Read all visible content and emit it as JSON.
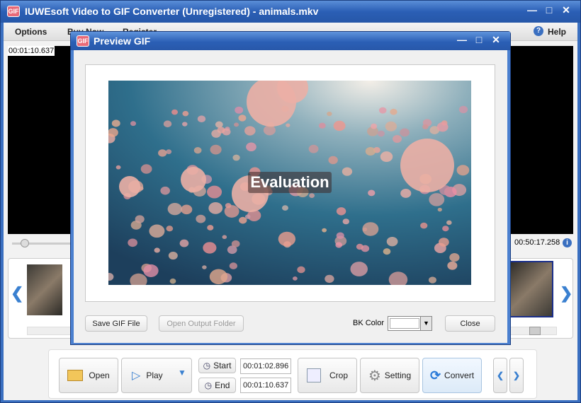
{
  "window": {
    "title": "IUWEsoft Video to GIF Converter (Unregistered) - animals.mkv",
    "icon": "app-logo-icon"
  },
  "menu": {
    "items": [
      "Options",
      "Buy Now",
      "Register"
    ],
    "help": "Help"
  },
  "player": {
    "current_time": "00:01:10.637",
    "total_time": "00:50:17.258",
    "position_fraction": 0.02
  },
  "toolbar": {
    "open": "Open",
    "play": "Play",
    "start": "Start",
    "end": "End",
    "start_time": "00:01:02.896",
    "end_time": "00:01:10.637",
    "crop": "Crop",
    "setting": "Setting",
    "convert": "Convert"
  },
  "dialog": {
    "title": "Preview GIF",
    "watermark": "Evaluation",
    "save": "Save GIF File",
    "open_folder": "Open Output Folder",
    "bk_color_label": "BK Color",
    "bk_color": "#ffffff",
    "close": "Close"
  },
  "colors": {
    "titlebar": "#2b5fb5",
    "accent": "#3a6fc0"
  }
}
